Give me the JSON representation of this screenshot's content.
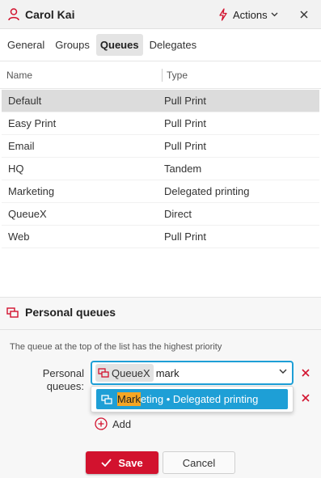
{
  "header": {
    "title": "Carol Kai",
    "actions_label": "Actions"
  },
  "tabs": [
    {
      "label": "General"
    },
    {
      "label": "Groups"
    },
    {
      "label": "Queues",
      "active": true
    },
    {
      "label": "Delegates"
    }
  ],
  "table": {
    "columns": [
      "Name",
      "Type"
    ],
    "rows": [
      {
        "name": "Default",
        "type": "Pull Print",
        "selected": true
      },
      {
        "name": "Easy Print",
        "type": "Pull Print"
      },
      {
        "name": "Email",
        "type": "Pull Print"
      },
      {
        "name": "HQ",
        "type": "Tandem"
      },
      {
        "name": "Marketing",
        "type": "Delegated printing"
      },
      {
        "name": "QueueX",
        "type": "Direct"
      },
      {
        "name": "Web",
        "type": "Pull Print"
      }
    ]
  },
  "personal_queues": {
    "title": "Personal queues",
    "hint": "The queue at the top of the list has the highest priority",
    "field_label": "Personal queues:",
    "selected_chip": "QueueX",
    "search_text": "mark",
    "option_highlight": "Mark",
    "option_rest": "eting • Delegated printing",
    "add_label": "Add"
  },
  "buttons": {
    "save": "Save",
    "cancel": "Cancel"
  },
  "colors": {
    "accent_red": "#d2122e",
    "accent_blue": "#1e9fd6",
    "highlight_orange": "#f5a623"
  }
}
